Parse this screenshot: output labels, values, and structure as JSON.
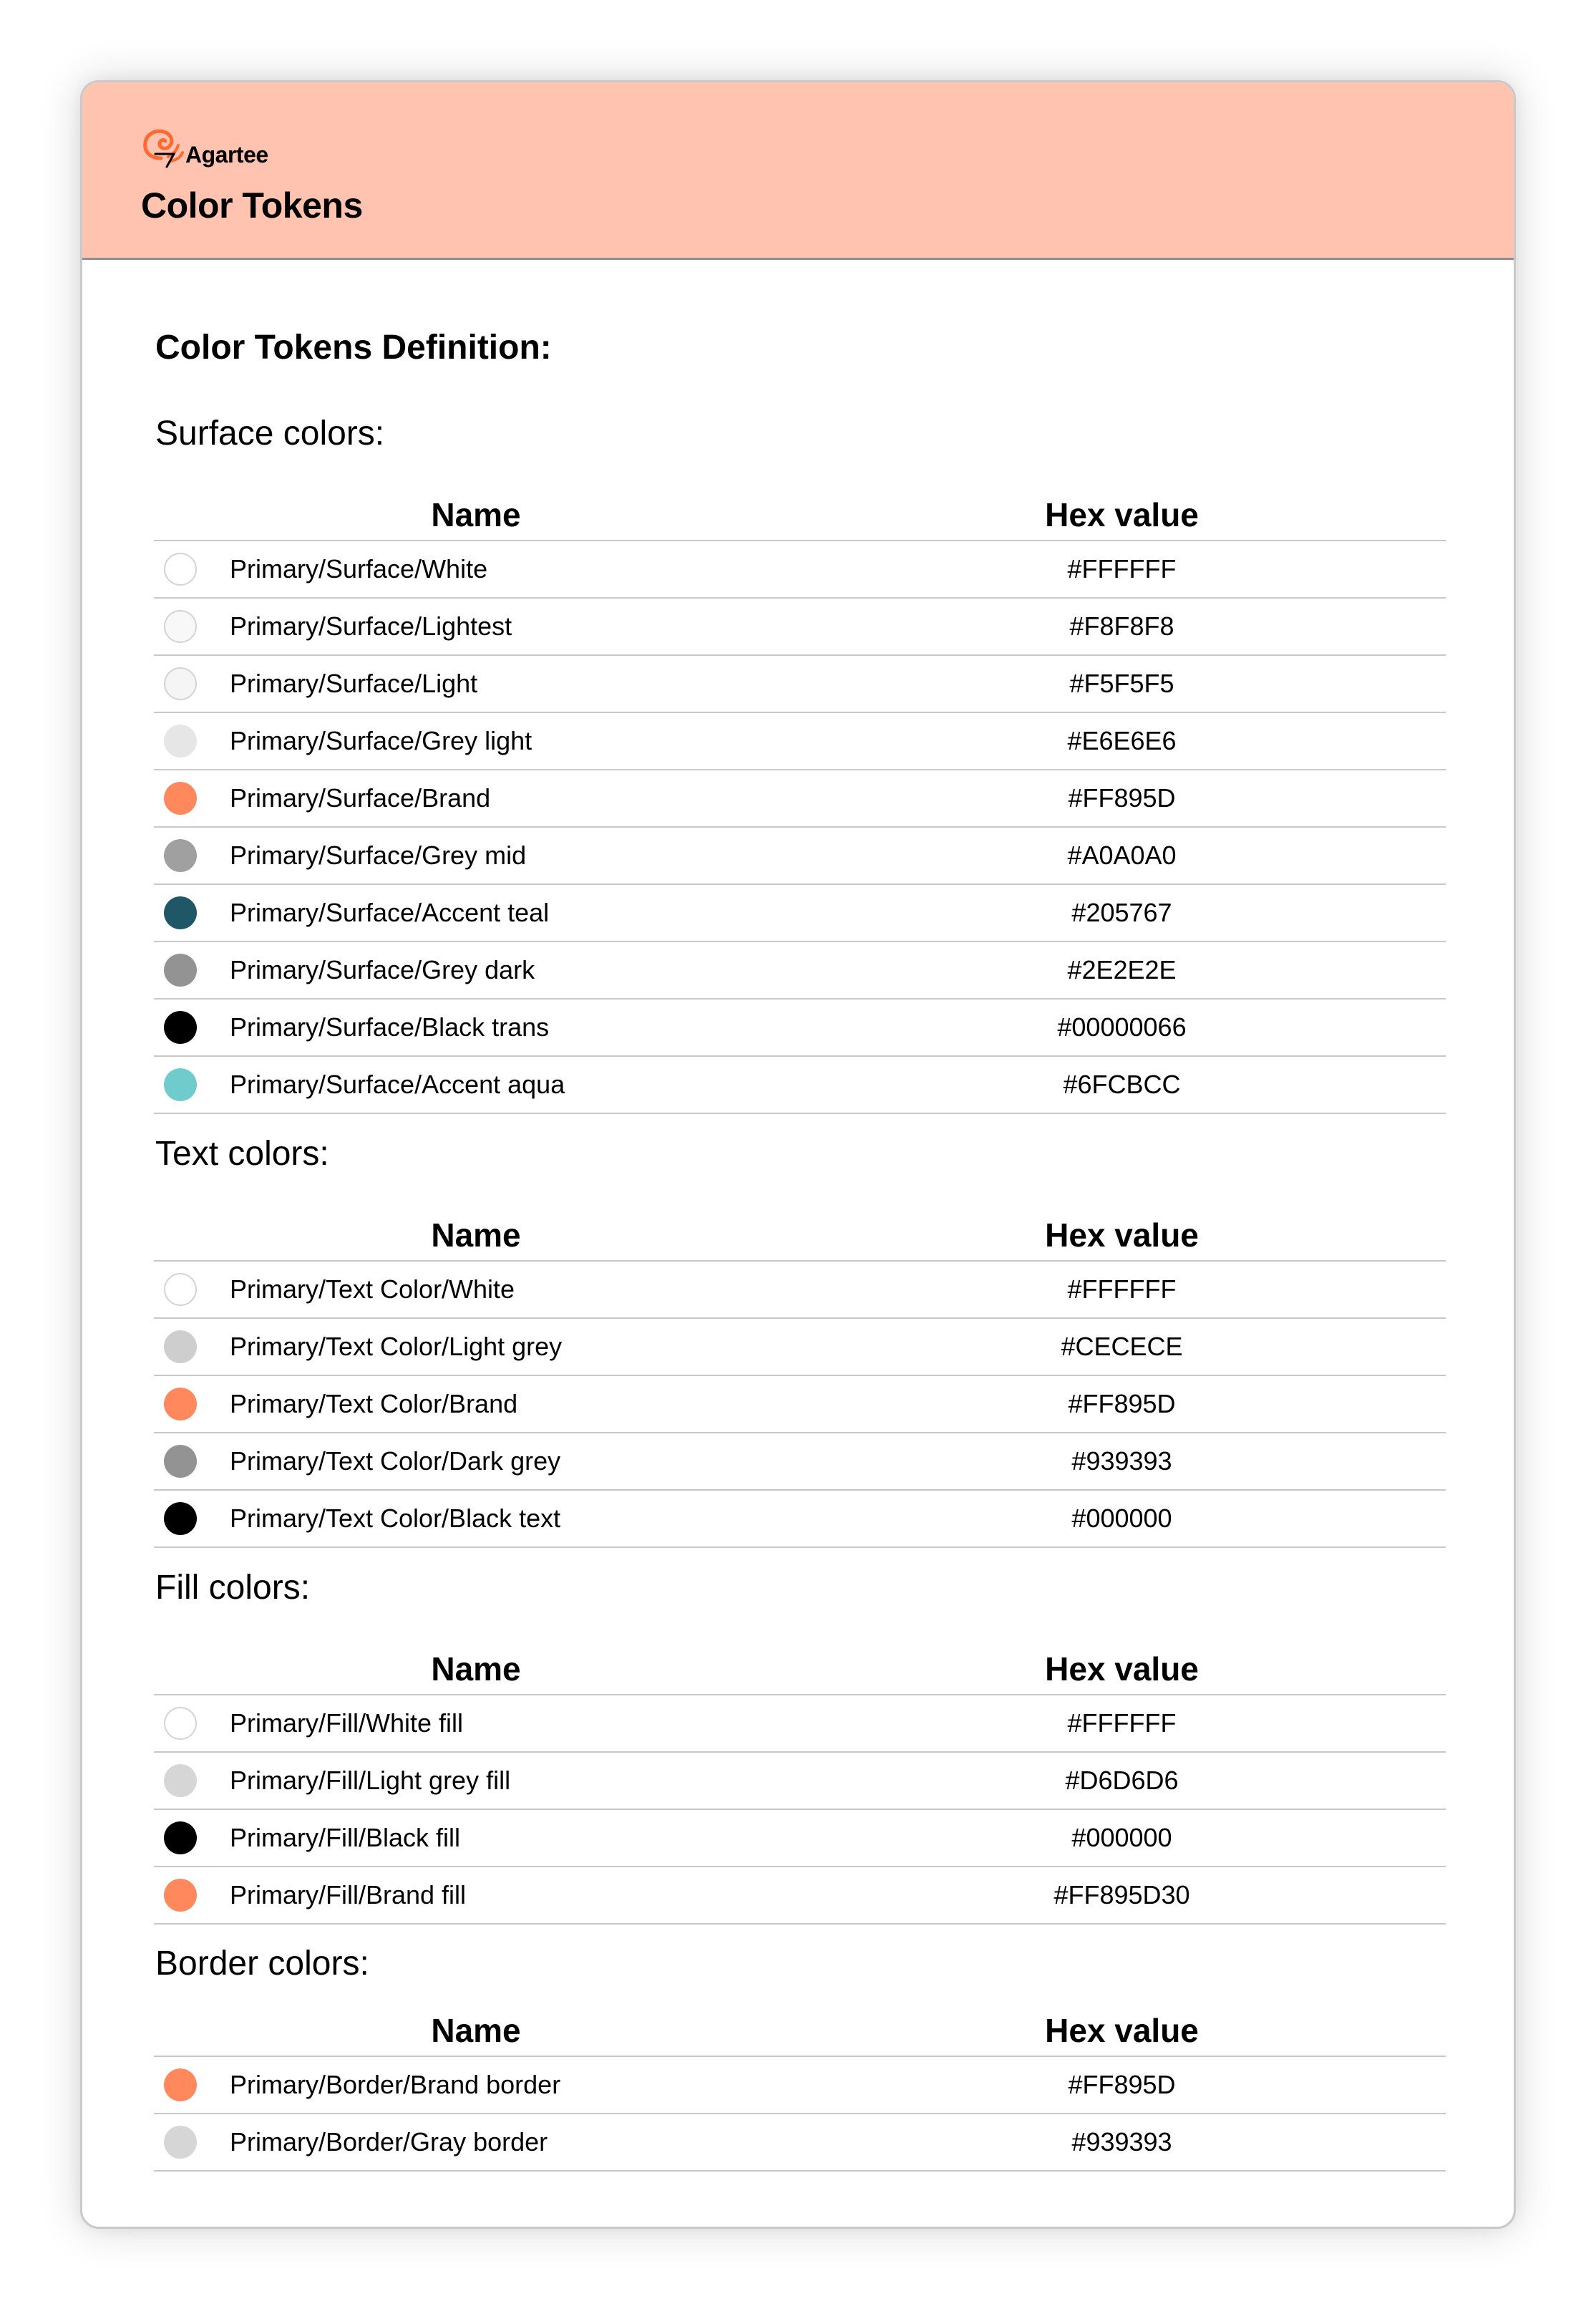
{
  "brand": {
    "logo_text": "Agartee",
    "logo_icon": "swirl-logo-icon",
    "accent": "#FF895D"
  },
  "header": {
    "title": "Color Tokens",
    "background": "#FFC3B0"
  },
  "page_title": "Color Tokens Definition:",
  "columns": {
    "name": "Name",
    "hex": "Hex value"
  },
  "sections": [
    {
      "title": "Surface colors:",
      "rows": [
        {
          "name": "Primary/Surface/White",
          "hex": "#FFFFFF",
          "swatch": "#FFFFFF"
        },
        {
          "name": "Primary/Surface/Lightest",
          "hex": "#F8F8F8",
          "swatch": "#F8F8F8"
        },
        {
          "name": "Primary/Surface/Light",
          "hex": "#F5F5F5",
          "swatch": "#F5F5F5"
        },
        {
          "name": "Primary/Surface/Grey light",
          "hex": "#E6E6E6",
          "swatch": "#E6E6E6"
        },
        {
          "name": "Primary/Surface/Brand",
          "hex": "#FF895D",
          "swatch": "#FF895D"
        },
        {
          "name": "Primary/Surface/Grey mid",
          "hex": "#A0A0A0",
          "swatch": "#A0A0A0"
        },
        {
          "name": "Primary/Surface/Accent teal",
          "hex": "#205767",
          "swatch": "#205767"
        },
        {
          "name": "Primary/Surface/Grey dark",
          "hex": "#2E2E2E",
          "swatch": "#939393"
        },
        {
          "name": "Primary/Surface/Black trans",
          "hex": "#00000066",
          "swatch": "#000000"
        },
        {
          "name": "Primary/Surface/Accent aqua",
          "hex": "#6FCBCC",
          "swatch": "#6FCBCC"
        }
      ]
    },
    {
      "title": "Text colors:",
      "rows": [
        {
          "name": "Primary/Text Color/White",
          "hex": "#FFFFFF",
          "swatch": "#FFFFFF"
        },
        {
          "name": "Primary/Text Color/Light grey",
          "hex": "#CECECE",
          "swatch": "#CECECE"
        },
        {
          "name": "Primary/Text Color/Brand",
          "hex": "#FF895D",
          "swatch": "#FF895D"
        },
        {
          "name": "Primary/Text Color/Dark grey",
          "hex": "#939393",
          "swatch": "#939393"
        },
        {
          "name": "Primary/Text Color/Black text",
          "hex": "#000000",
          "swatch": "#000000"
        }
      ]
    },
    {
      "title": "Fill colors:",
      "rows": [
        {
          "name": "Primary/Fill/White fill",
          "hex": "#FFFFFF",
          "swatch": "#FFFFFF"
        },
        {
          "name": "Primary/Fill/Light grey fill",
          "hex": "#D6D6D6",
          "swatch": "#D6D6D6"
        },
        {
          "name": "Primary/Fill/Black fill",
          "hex": "#000000",
          "swatch": "#000000"
        },
        {
          "name": "Primary/Fill/Brand fill",
          "hex": "#FF895D30",
          "swatch": "#FF895D"
        }
      ]
    },
    {
      "title": "Border colors:",
      "rows": [
        {
          "name": "Primary/Border/Brand border",
          "hex": "#FF895D",
          "swatch": "#FF895D"
        },
        {
          "name": "Primary/Border/Gray border",
          "hex": "#939393",
          "swatch": "#D6D6D6"
        }
      ]
    }
  ]
}
